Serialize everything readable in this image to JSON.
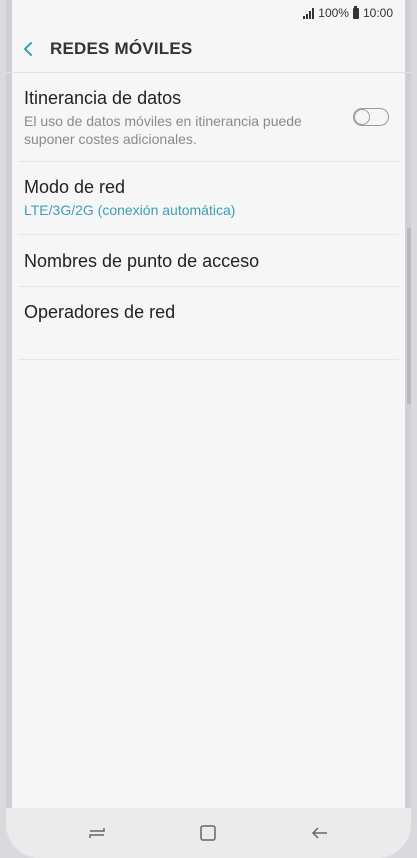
{
  "status_bar": {
    "battery": "100%",
    "time": "10:00"
  },
  "header": {
    "title": "REDES MÓVILES"
  },
  "settings": {
    "roaming": {
      "title": "Itinerancia de datos",
      "subtitle": "El uso de datos móviles en itinerancia puede suponer costes adicionales.",
      "enabled": false
    },
    "network_mode": {
      "title": "Modo de red",
      "value": "LTE/3G/2G (conexión automática)"
    },
    "apn": {
      "title": "Nombres de punto de acceso"
    },
    "operators": {
      "title": "Operadores de red"
    }
  },
  "colors": {
    "accent": "#3aa0b5",
    "background": "#f6f6f6"
  },
  "icons": {
    "back": "chevron-left-icon",
    "signal": "signal-icon",
    "battery": "battery-icon",
    "recents": "recent-apps-icon",
    "home": "home-icon",
    "nav_back": "back-arrow-icon"
  }
}
